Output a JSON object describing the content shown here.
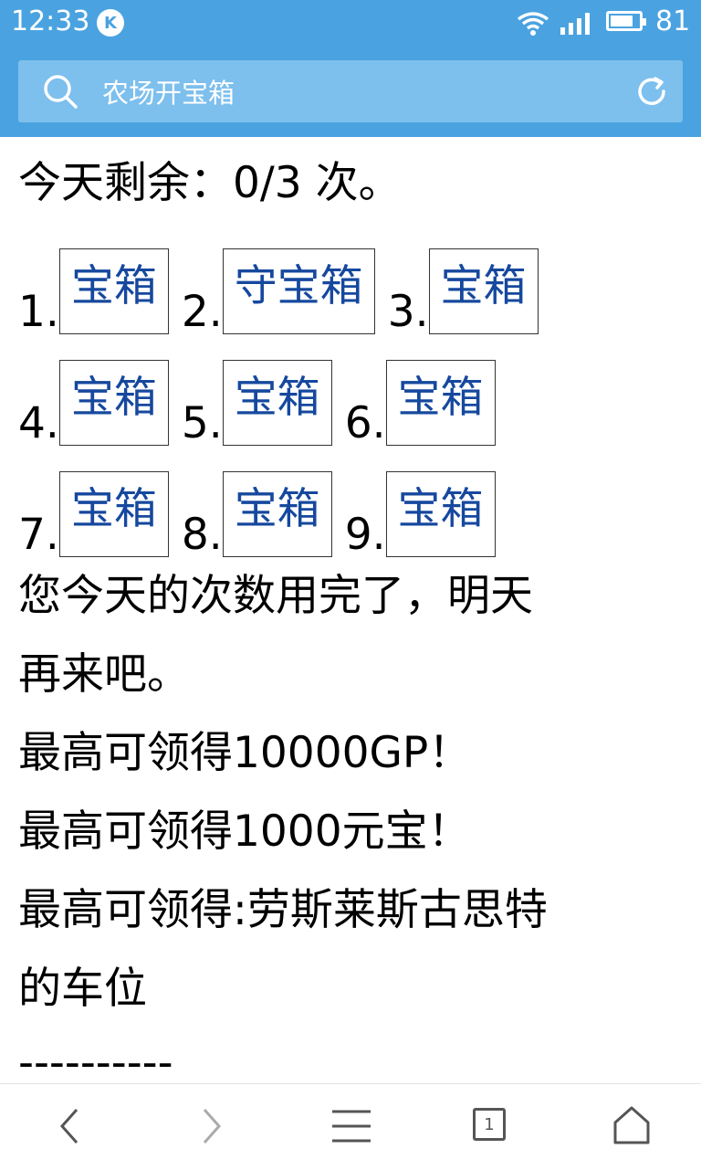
{
  "status": {
    "time": "12:33",
    "app_badge": "K",
    "battery_level": "81",
    "battery_fraction": 0.81
  },
  "search": {
    "query": "农场开宝箱"
  },
  "content": {
    "remaining": "今天剩余：0/3 次。",
    "chests": [
      {
        "num": "1.",
        "label": "宝箱"
      },
      {
        "num": "2.",
        "label": "守宝箱"
      },
      {
        "num": "3.",
        "label": "宝箱"
      },
      {
        "num": "4.",
        "label": "宝箱"
      },
      {
        "num": "5.",
        "label": "宝箱"
      },
      {
        "num": "6.",
        "label": "宝箱"
      },
      {
        "num": "7.",
        "label": "宝箱"
      },
      {
        "num": "8.",
        "label": "宝箱"
      },
      {
        "num": "9.",
        "label": "宝箱"
      }
    ],
    "used_up_line1": "您今天的次数用完了，明天",
    "used_up_line2": "再来吧。",
    "reward_gp": "最高可领得10000GP！",
    "reward_yuanbao": "最高可领得1000元宝！",
    "reward_car_line1": "最高可领得:劳斯莱斯古思特",
    "reward_car_line2": "的车位",
    "separator": "----------"
  },
  "bottom_nav": {
    "tab_count": "1"
  },
  "colors": {
    "header": "#4aa3e0",
    "search_box": "#7dbfed",
    "chest_link": "#16489e"
  }
}
